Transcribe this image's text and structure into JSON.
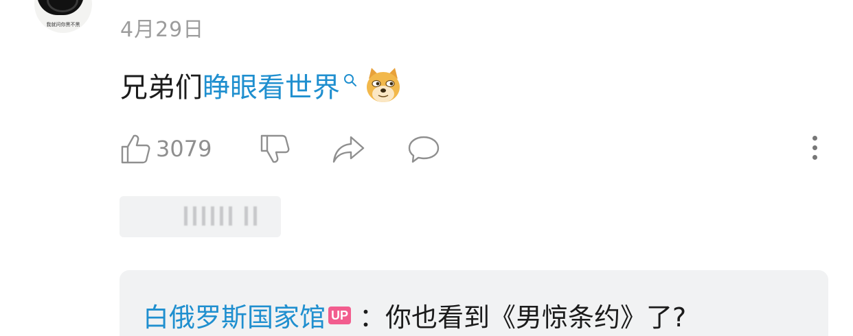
{
  "avatar": {
    "caption": "我就问你黑不黑"
  },
  "comment": {
    "date": "4月29日",
    "text_prefix": "兄弟们",
    "text_link": "睁眼看世界",
    "emoji_icon": "doge-emoji-icon"
  },
  "actions": {
    "like_count": "3079",
    "icons": [
      "thumbs-up-icon",
      "thumbs-down-icon",
      "share-icon",
      "comment-icon",
      "more-vertical-icon"
    ]
  },
  "reply": {
    "author": "白俄罗斯国家馆",
    "badge": "UP",
    "text": "：你也看到《男惊条约》了?"
  },
  "colors": {
    "link": "#1f8fcf",
    "badge": "#f25d8e",
    "secondary_text": "#9c9c9c",
    "reply_bg": "#f1f2f3"
  }
}
